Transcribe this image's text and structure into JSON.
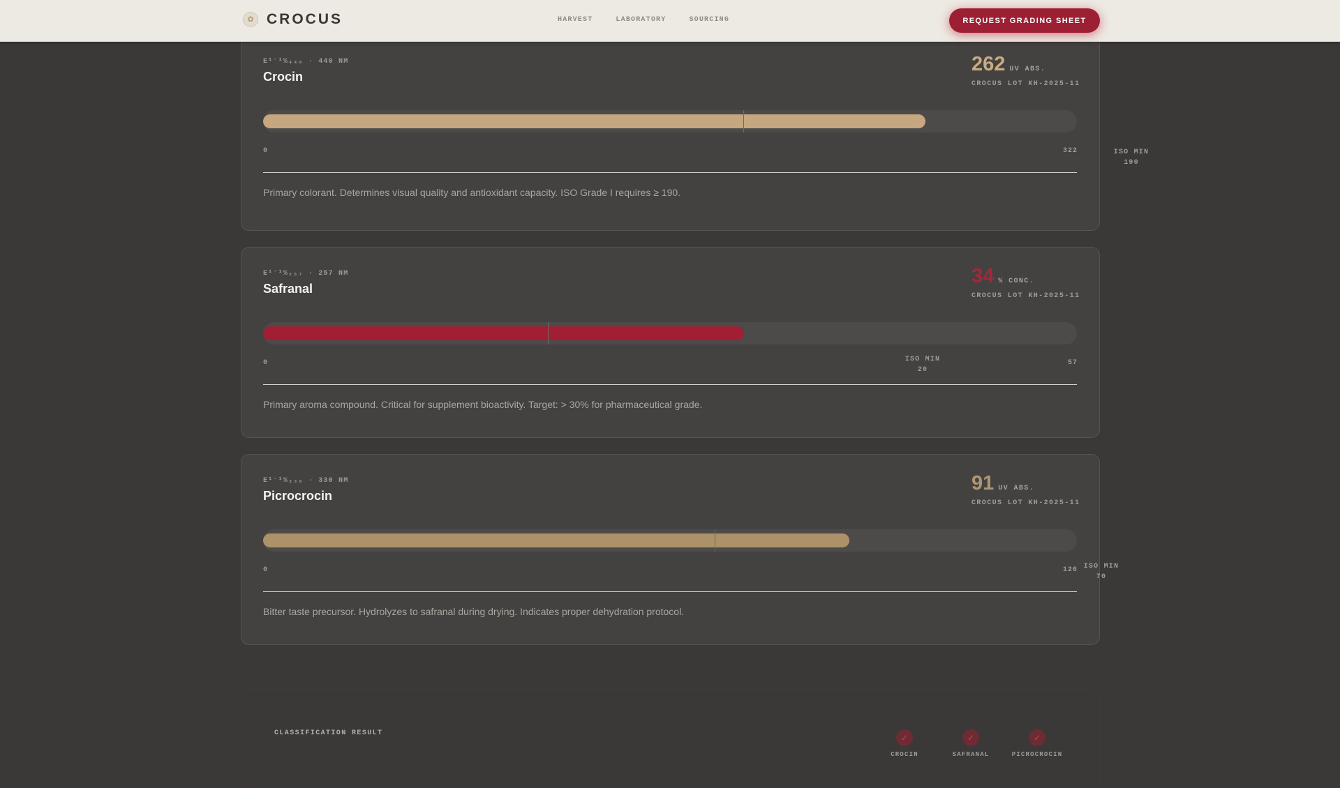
{
  "header": {
    "brand": "CROCUS",
    "nav": [
      "HARVEST",
      "LABORATORY",
      "SOURCING"
    ],
    "cta": "REQUEST GRADING SHEET"
  },
  "cards": [
    {
      "formula": "E¹⁻¹%₄₄₀ · 440 NM",
      "title": "Crocin",
      "value": "262",
      "unit": "UV ABS.",
      "lot": "CROCUS LOT KH-2025-11",
      "scale_min": "0",
      "scale_max": "322",
      "iso_line1": "ISO MIN",
      "iso_line2": "190",
      "fill_fraction": 0.814,
      "iso_fraction": 0.59,
      "fill_color": "#c6a77f",
      "value_color": "#c9ab82",
      "description": "Primary colorant. Determines visual quality and antioxidant capacity. ISO Grade I requires ≥ 190."
    },
    {
      "formula": "E¹⁻¹%₂₅₇ · 257 NM",
      "title": "Safranal",
      "value": "34",
      "unit": "% CONC.",
      "lot": "CROCUS LOT KH-2025-11",
      "scale_min": "0",
      "scale_max": "57",
      "iso_line1": "ISO MIN",
      "iso_line2": "20",
      "fill_fraction": 0.591,
      "iso_fraction": 0.35,
      "fill_color": "#a01f33",
      "value_color": "#a3283a",
      "description": "Primary aroma compound. Critical for supplement bioactivity. Target: > 30% for pharmaceutical grade."
    },
    {
      "formula": "E¹⁻¹%₃₃₀ · 330 NM",
      "title": "Picrocrocin",
      "value": "91",
      "unit": "UV ABS.",
      "lot": "CROCUS LOT KH-2025-11",
      "scale_min": "0",
      "scale_max": "126",
      "iso_line1": "ISO MIN",
      "iso_line2": "70",
      "fill_fraction": 0.72,
      "iso_fraction": 0.555,
      "fill_color": "#ad9168",
      "value_color": "#b09671",
      "description": "Bitter taste precursor. Hydrolyzes to safranal during drying. Indicates proper dehydration protocol."
    }
  ],
  "classification": {
    "label": "CLASSIFICATION RESULT",
    "checks": [
      "CROCIN",
      "SAFRANAL",
      "PICROCROCIN"
    ]
  }
}
